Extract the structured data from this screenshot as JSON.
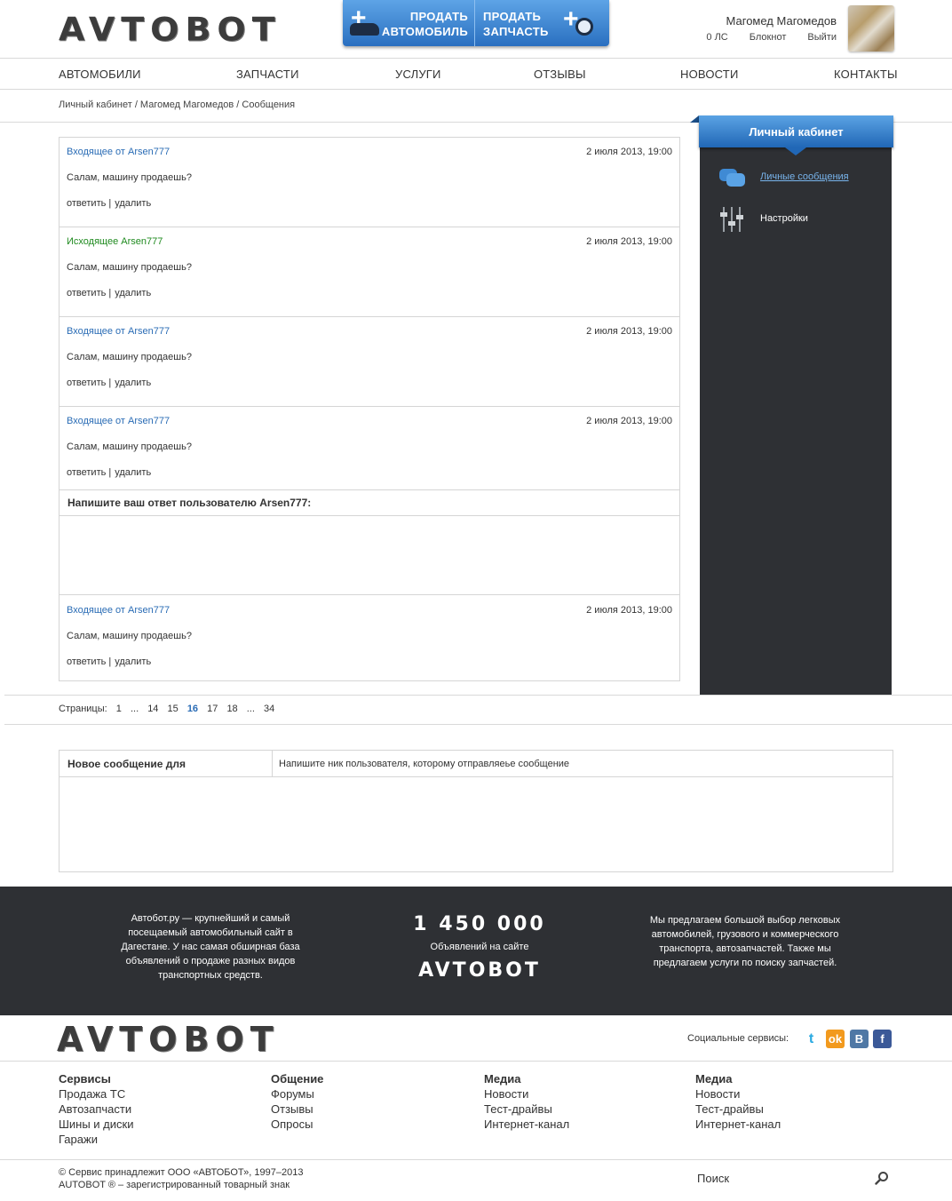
{
  "header": {
    "logo": "AVTOBOT",
    "sell_car": {
      "line1": "ПРОДАТЬ",
      "line2": "АВТОМОБИЛЬ"
    },
    "sell_part": {
      "line1": "ПРОДАТЬ",
      "line2": "ЗАПЧАСТЬ"
    },
    "user_name": "Магомед Магомедов",
    "links": [
      "0 ЛС",
      "Блокнот",
      "Выйти"
    ]
  },
  "nav": [
    "АВТОМОБИЛИ",
    "ЗАПЧАСТИ",
    "УСЛУГИ",
    "ОТЗЫВЫ",
    "НОВОСТИ",
    "КОНТАКТЫ"
  ],
  "breadcrumb": "Личный кабинет / Магомед Магомедов / Сообщения",
  "sidebar": {
    "title": "Личный кабинет",
    "items": [
      {
        "label": "Личные сообщения",
        "icon": "chat-bubbles-icon"
      },
      {
        "label": "Настройки",
        "icon": "sliders-icon"
      }
    ]
  },
  "messages": [
    {
      "from": "Входящее от Arsen777",
      "direction": "in",
      "date": "2 июля 2013, 19:00",
      "text": "Салам, машину продаешь?",
      "reply": "ответить",
      "sep": "|",
      "delete": "удалить"
    },
    {
      "from": "Исходящее Arsen777",
      "direction": "out",
      "date": "2 июля 2013, 19:00",
      "text": "Салам, машину продаешь?",
      "reply": "ответить",
      "sep": "|",
      "delete": "удалить"
    },
    {
      "from": "Входящее от Arsen777",
      "direction": "in",
      "date": "2 июля 2013, 19:00",
      "text": "Салам, машину продаешь?",
      "reply": "ответить",
      "sep": "|",
      "delete": "удалить"
    },
    {
      "from": "Входящее от Arsen777",
      "direction": "in",
      "date": "2 июля 2013, 19:00",
      "text": "Салам, машину продаешь?",
      "reply": "ответить",
      "sep": "|",
      "delete": "удалить"
    },
    {
      "from": "Входящее от Arsen777",
      "direction": "in",
      "date": "2 июля 2013, 19:00",
      "text": "Салам, машину продаешь?",
      "reply": "ответить",
      "sep": "|",
      "delete": "удалить"
    }
  ],
  "reply_prompt": "Напишите ваш ответ пользователю Arsen777:",
  "pagination": {
    "label": "Страницы:",
    "pages": [
      "1",
      "...",
      "14",
      "15",
      "16",
      "17",
      "18",
      "...",
      "34"
    ],
    "current": "16"
  },
  "new_message": {
    "label": "Новое сообщение для",
    "placeholder": "Напишите ник пользователя, которому отправляеье сообщение"
  },
  "band": {
    "left": "Автобот.ру — крупнейший и самый посещаемый автомобильный сайт в Дагестане. У нас самая обширная база объявлений о продаже разных видов транспортных средств.",
    "count": "1 450 000",
    "count_label": "Объявлений на сайте",
    "logo": "AVTOBOT",
    "right": "Мы предлагаем большой выбор легковых автомобилей, грузового и коммерческого транспорта, автозапчастей. Также мы предлагаем услуги по поиску запчастей."
  },
  "footer": {
    "logo": "AVTOBOT",
    "social_label": "Социальные сервисы:",
    "social": [
      {
        "icon": "twitter-icon",
        "glyph": "t"
      },
      {
        "icon": "odnoklassniki-icon",
        "glyph": "ok"
      },
      {
        "icon": "vkontakte-icon",
        "glyph": "B"
      },
      {
        "icon": "facebook-icon",
        "glyph": "f"
      }
    ],
    "columns": [
      {
        "title": "Сервисы",
        "links": [
          "Продажа ТС",
          "Автозапчасти",
          "Шины и диски",
          "Гаражи"
        ]
      },
      {
        "title": "Общение",
        "links": [
          "Форумы",
          "Отзывы",
          "Опросы"
        ]
      },
      {
        "title": "Медиа",
        "links": [
          "Новости",
          "Тест-драйвы",
          "Интернет-канал"
        ]
      },
      {
        "title": "Медиа",
        "links": [
          "Новости",
          "Тест-драйвы",
          "Интернет-канал"
        ]
      }
    ],
    "copyright": "© Сервис принадлежит ООО «АВТОБОТ», 1997–2013",
    "trademark": "AUTOBOT ® – зарегистрированный товарный знак",
    "search_placeholder": "Поиск"
  },
  "colors": {
    "accent": "#2a6cb5",
    "outgoing": "#1f8a1f",
    "dark": "#2e3034"
  }
}
